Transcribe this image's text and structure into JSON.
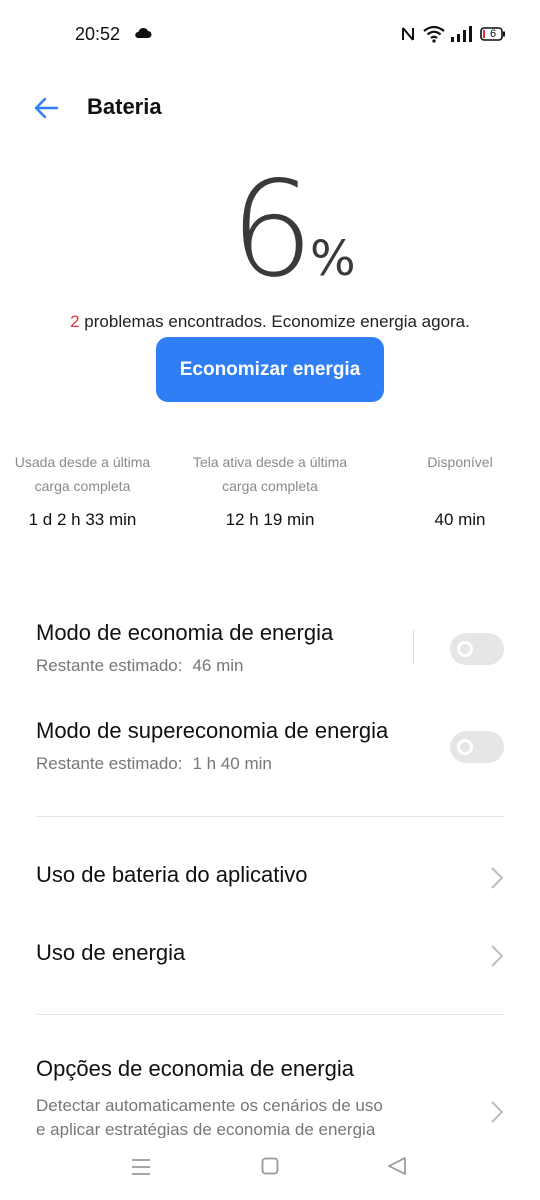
{
  "status_bar": {
    "time": "20:52",
    "battery_level": "6",
    "icons": [
      "cloud-icon",
      "nfc-icon",
      "wifi-icon",
      "signal-icon",
      "battery-icon"
    ]
  },
  "header": {
    "title": "Bateria",
    "back_icon": "arrow-left-icon"
  },
  "battery": {
    "percent_value": "6",
    "percent_sign": "%",
    "problems_count": "2",
    "problems_text": " problemas encontrados. Economize energia agora.",
    "save_button_label": "Economizar energia"
  },
  "stats": [
    {
      "label_line1": "Usada desde a última",
      "label_line2": "carga completa",
      "value": "1 d 2 h 33 min"
    },
    {
      "label_line1": "Tela ativa desde a última",
      "label_line2": "carga completa",
      "value": "12 h 19 min"
    },
    {
      "label_line1": "Disponível",
      "label_line2": "",
      "value": "40 min"
    }
  ],
  "modes": [
    {
      "title": "Modo de economia de energia",
      "sub_label": "Restante estimado:",
      "sub_value": "46 min",
      "enabled": false
    },
    {
      "title": "Modo de supereconomia de energia",
      "sub_label": "Restante estimado:",
      "sub_value": "1 h 40 min",
      "enabled": false
    }
  ],
  "links": [
    {
      "title": "Uso de bateria do aplicativo"
    },
    {
      "title": "Uso de energia"
    }
  ],
  "options": {
    "title": "Opções de economia de energia",
    "desc_line1": "Detectar automaticamente os cenários de uso",
    "desc_line2": "e aplicar estratégias de economia de energia"
  },
  "colors": {
    "accent": "#2f7ef6",
    "problem_red": "#e0343a",
    "toggle_off": "#e6e6e6"
  },
  "nav_bar": {
    "icons": [
      "menu-icon",
      "home-square-icon",
      "back-triangle-icon"
    ]
  }
}
